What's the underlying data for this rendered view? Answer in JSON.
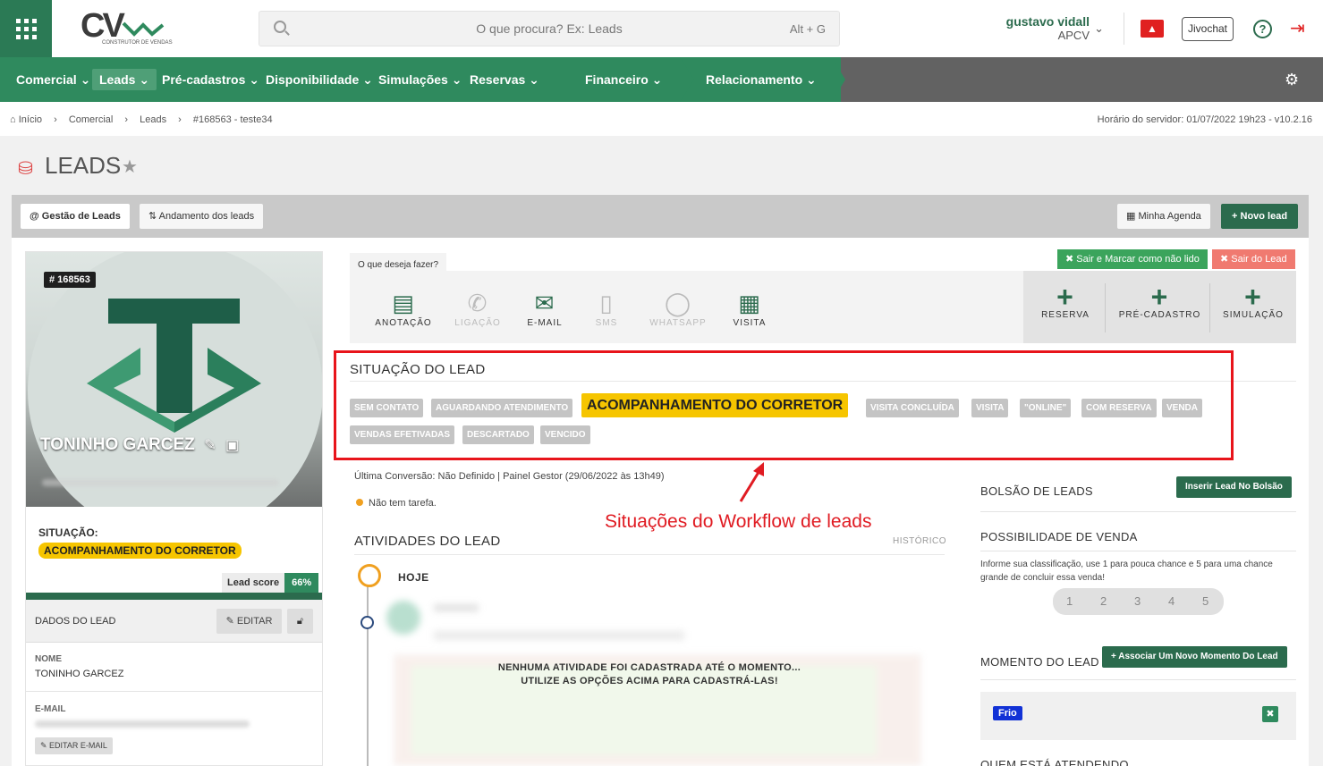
{
  "search": {
    "placeholder": "O que procura? Ex: Leads",
    "shortcut": "Alt + G"
  },
  "logo": {
    "text": "CV",
    "subtitle": "CONSTRUTOR DE VENDAS"
  },
  "user": {
    "name": "gustavo vidall",
    "role": "APCV"
  },
  "header": {
    "jivochat": "Jivochat",
    "help": "?"
  },
  "nav": {
    "items": [
      "Comercial",
      "Leads",
      "Pré-cadastros",
      "Disponibilidade",
      "Simulações",
      "Reservas",
      "Financeiro",
      "Relacionamento"
    ],
    "active": "Leads"
  },
  "breadcrumb": {
    "items": [
      "Início",
      "Comercial",
      "Leads",
      "#168563 - teste34"
    ],
    "server_time": "Horário do servidor: 01/07/2022 19h23 - v10.2.16"
  },
  "page": {
    "title": "LEADS"
  },
  "toolbar": {
    "tab1": "Gestão de Leads",
    "tab2": "Andamento dos leads",
    "agenda": "Minha Agenda",
    "novo": "Novo lead"
  },
  "lead": {
    "id": "# 168563",
    "name": "TONINHO GARCEZ",
    "situacao_label": "SITUAÇÃO:",
    "situacao": "ACOMPANHAMENTO DO CORRETOR",
    "score_label": "Lead score",
    "score": "66%",
    "dados_label": "DADOS DO LEAD",
    "editar": "EDITAR",
    "nome_label": "NOME",
    "nome": "TONINHO GARCEZ",
    "email_label": "E-MAIL",
    "editar_email": "EDITAR E-MAIL"
  },
  "actions": {
    "label": "O que deseja fazer?",
    "items": [
      "ANOTAÇÃO",
      "LIGAÇÃO",
      "E-MAIL",
      "SMS",
      "WHATSAPP",
      "VISITA"
    ],
    "quick": [
      "RESERVA",
      "PRÉ-CADASTRO",
      "SIMULAÇÃO"
    ],
    "sair_marcar": "Sair e Marcar como não lido",
    "sair": "Sair do Lead"
  },
  "situacao": {
    "title": "SITUAÇÃO DO LEAD",
    "tags": [
      "SEM CONTATO",
      "AGUARDANDO ATENDIMENTO",
      "ACOMPANHAMENTO DO CORRETOR",
      "VISITA CONCLUÍDA",
      "VISITA",
      "\"ONLINE\"",
      "COM RESERVA",
      "VENDA",
      "VENDAS EFETIVADAS",
      "DESCARTADO",
      "VENCIDO"
    ],
    "active": "ACOMPANHAMENTO DO CORRETOR"
  },
  "annotation": "Situações do Workflow de leads",
  "info": {
    "conversao": "Última Conversão: Não Definido | Painel Gestor (29/06/2022 às 13h49)",
    "tarefa": "Não tem tarefa."
  },
  "atividades": {
    "title": "ATIVIDADES DO LEAD",
    "historico": "HISTÓRICO",
    "hoje": "HOJE",
    "empty_line1": "NENHUMA ATIVIDADE FOI CADASTRADA ATÉ O MOMENTO...",
    "empty_line2": "UTILIZE AS OPÇÕES ACIMA PARA CADASTRÁ-LAS!"
  },
  "right": {
    "bolsao_title": "BOLSÃO DE LEADS",
    "bolsao_btn": "Inserir Lead No Bolsão",
    "poss_title": "POSSIBILIDADE DE VENDA",
    "poss_desc": "Informe sua classificação, use 1 para pouca chance e 5 para uma chance grande de concluir essa venda!",
    "ratings": [
      "1",
      "2",
      "3",
      "4",
      "5"
    ],
    "momento_title": "MOMENTO DO LEAD",
    "momento_btn": "Associar Um Novo Momento Do Lead",
    "momento_tag": "Frio",
    "quem_title": "QUEM ESTÁ ATENDENDO"
  },
  "colors": {
    "primary": "#2f8a5e",
    "dark_green": "#2b6b4d",
    "highlight": "#f6c500",
    "annotation": "#e01b22",
    "danger": "#e02020"
  }
}
